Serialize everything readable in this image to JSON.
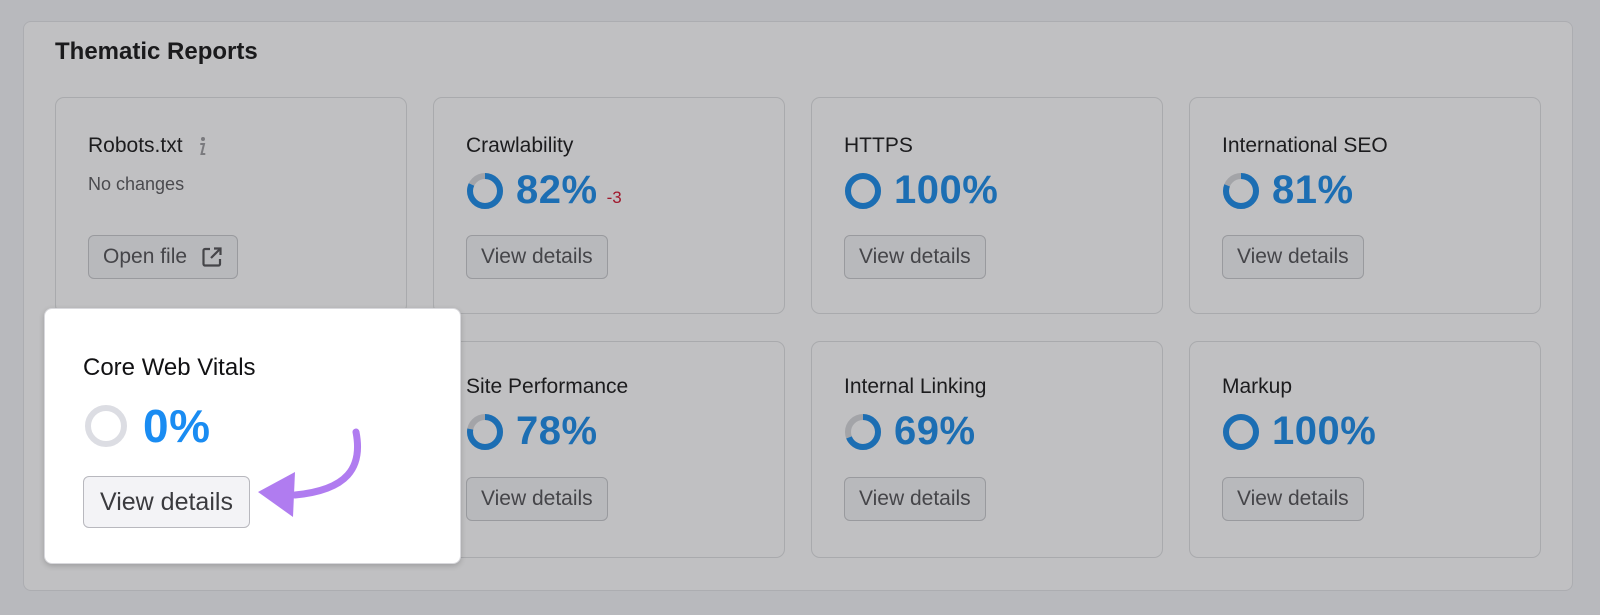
{
  "section": {
    "title": "Thematic Reports"
  },
  "robots": {
    "title": "Robots.txt",
    "status": "No changes",
    "button_label": "Open file"
  },
  "cards": [
    {
      "title": "Crawlability",
      "score": "82%",
      "percent": 82,
      "delta": "-3",
      "button_label": "View details"
    },
    {
      "title": "HTTPS",
      "score": "100%",
      "percent": 100,
      "button_label": "View details"
    },
    {
      "title": "International SEO",
      "score": "81%",
      "percent": 81,
      "button_label": "View details"
    },
    {
      "title": "Site Performance",
      "score": "78%",
      "percent": 78,
      "button_label": "View details"
    },
    {
      "title": "Internal Linking",
      "score": "69%",
      "percent": 69,
      "button_label": "View details"
    },
    {
      "title": "Markup",
      "score": "100%",
      "percent": 100,
      "button_label": "View details"
    }
  ],
  "core_web_vitals": {
    "title": "Core Web Vitals",
    "score": "0%",
    "percent": 0,
    "button_label": "View details"
  },
  "colors": {
    "accent_blue": "#1c6eb3",
    "highlight_blue": "#1a8cf2",
    "delta_red": "#a0182c",
    "arrow_purple": "#b07cf0",
    "donut_track": "#a3a4a8"
  }
}
